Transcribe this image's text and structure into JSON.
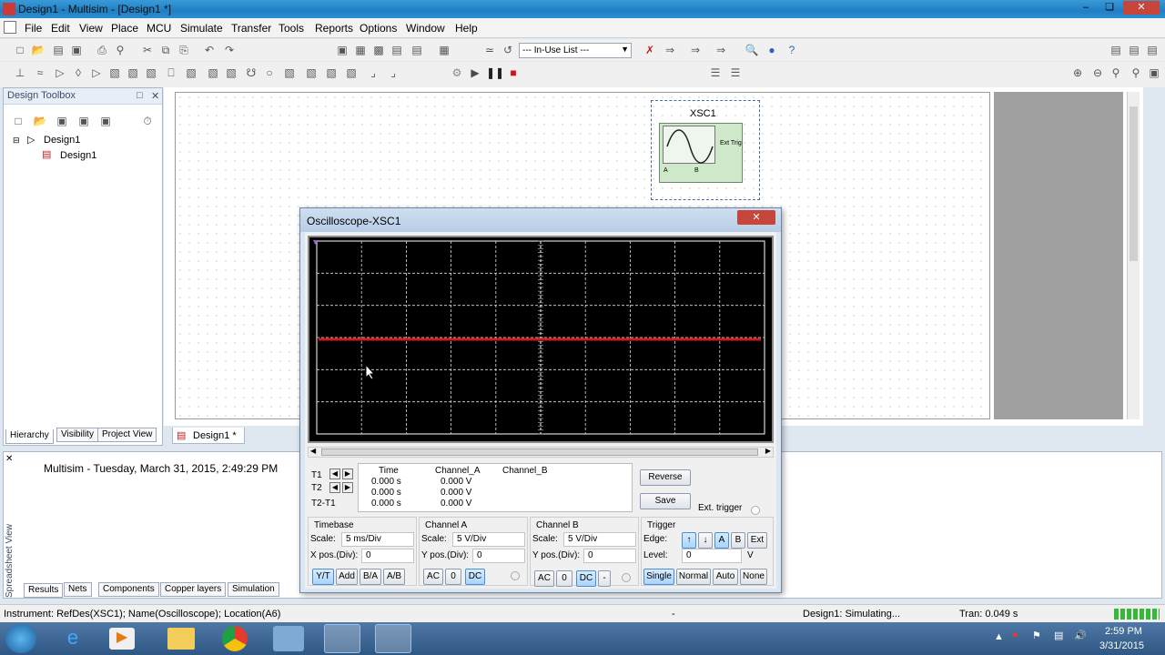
{
  "window": {
    "title": "Design1 - Multisim - [Design1 *]"
  },
  "menubar": {
    "items": [
      "File",
      "Edit",
      "View",
      "Place",
      "MCU",
      "Simulate",
      "Transfer",
      "Tools",
      "Reports",
      "Options",
      "Window",
      "Help"
    ]
  },
  "toolbar": {
    "inuse_list": "--- In-Use List ---"
  },
  "toolbox": {
    "title": "Design Toolbox",
    "tree_root": "Design1",
    "tree_child": "Design1",
    "tabs": [
      "Hierarchy",
      "Visibility",
      "Project View"
    ]
  },
  "canvas": {
    "tab": "Design1 *",
    "instrument_label": "XSC1",
    "instrument_ext_trig": "Ext Trig",
    "instrument_a": "A",
    "instrument_b": "B"
  },
  "spreadsheet": {
    "side_label": "Spreadsheet View",
    "log": "Multisim  -  Tuesday, March 31, 2015, 2:49:29 PM",
    "tabs": [
      "Results",
      "Nets",
      "Components",
      "Copper layers",
      "Simulation"
    ]
  },
  "oscilloscope": {
    "title": "Oscilloscope-XSC1",
    "readout": {
      "headers": [
        "Time",
        "Channel_A",
        "Channel_B"
      ],
      "rows": [
        {
          "label": "T1",
          "time": "0.000 s",
          "a": "0.000 V"
        },
        {
          "label": "T2",
          "time": "0.000 s",
          "a": "0.000 V"
        },
        {
          "label": "T2-T1",
          "time": "0.000 s",
          "a": "0.000 V"
        }
      ]
    },
    "buttons": {
      "reverse": "Reverse",
      "save": "Save",
      "ext_trigger": "Ext. trigger"
    },
    "timebase": {
      "title": "Timebase",
      "scale_label": "Scale:",
      "scale": "5 ms/Div",
      "xpos_label": "X pos.(Div):",
      "xpos": "0",
      "modes": [
        "Y/T",
        "Add",
        "B/A",
        "A/B"
      ]
    },
    "channel_a": {
      "title": "Channel A",
      "scale_label": "Scale:",
      "scale": "5  V/Div",
      "ypos_label": "Y pos.(Div):",
      "ypos": "0",
      "coupling": [
        "AC",
        "0",
        "DC"
      ]
    },
    "channel_b": {
      "title": "Channel B",
      "scale_label": "Scale:",
      "scale": "5  V/Div",
      "ypos_label": "Y pos.(Div):",
      "ypos": "0",
      "coupling": [
        "AC",
        "0",
        "DC",
        "-"
      ]
    },
    "trigger": {
      "title": "Trigger",
      "edge_label": "Edge:",
      "level_label": "Level:",
      "level": "0",
      "level_unit": "V",
      "sources": [
        "A",
        "B",
        "Ext"
      ],
      "modes": [
        "Single",
        "Normal",
        "Auto",
        "None"
      ]
    },
    "trace_color": "#d11a1a"
  },
  "status": {
    "left": "Instrument: RefDes(XSC1); Name(Oscilloscope); Location(A6)",
    "mid": "-",
    "sim": "Design1: Simulating...",
    "tran": "Tran: 0.049 s"
  },
  "taskbar": {
    "time": "2:59 PM",
    "date": "3/31/2015"
  }
}
